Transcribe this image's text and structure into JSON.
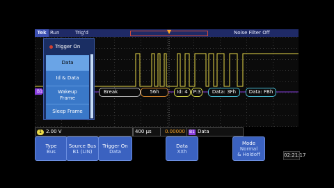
{
  "topbar": {
    "logo": "Tek",
    "run": "Run",
    "trig_state": "Trig'd",
    "noise_filter": "Noise Filter Off"
  },
  "menu": {
    "title": "Trigger On",
    "items": [
      "Data",
      "Id & Data",
      "Wakeup\nFrame",
      "Sleep Frame"
    ]
  },
  "decode": {
    "channel_marker": "B1",
    "packets": [
      "Break",
      "56h",
      "Id: 4",
      "P:3",
      "Data: 3Fh",
      "Data: FBh"
    ]
  },
  "readouts": {
    "ch1_marker": "1",
    "ch1_scale": "2.00 V",
    "timebase": "400 µs",
    "trig_time": "0.00000 s",
    "bus_marker": "B1",
    "trigger_type": "Data"
  },
  "buttons": {
    "type": {
      "label": "Type",
      "value": "Bus"
    },
    "source": {
      "label": "Source Bus",
      "value": "B1 (LIN)"
    },
    "trigger_on": {
      "label": "Trigger On",
      "value": "Data"
    },
    "data": {
      "label": "Data",
      "value": "XXh"
    },
    "mode": {
      "label": "Mode",
      "value": "Normal\n& Holdoff"
    }
  },
  "clock": "02:21:17",
  "colors": {
    "waveform": "#e8d84a",
    "decode_bus": "#8a3fe0",
    "accent": "#3b62c0",
    "trigger": "#ffa726"
  }
}
